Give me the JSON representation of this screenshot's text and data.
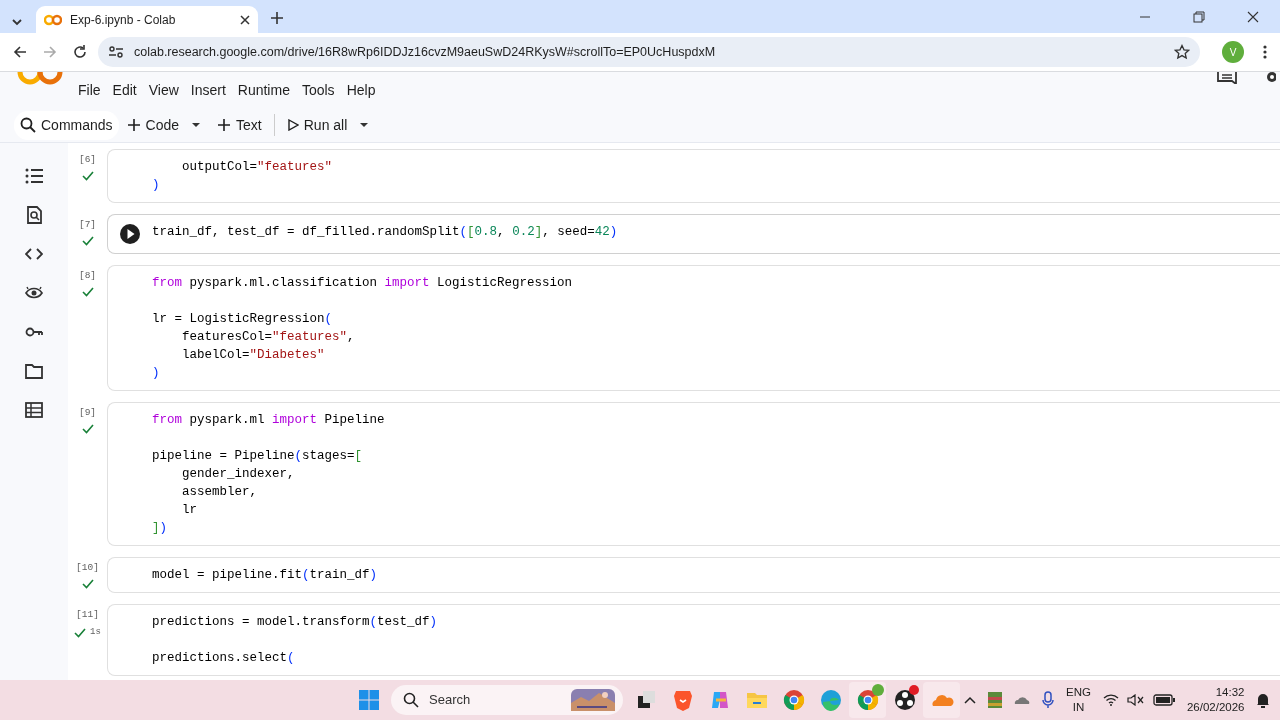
{
  "browser": {
    "tab_title": "Exp-6.ipynb - Colab",
    "url": "colab.research.google.com/drive/16R8wRp6IDDJz16cvzM9aeuSwD24RKysW#scrollTo=EP0UcHuspdxM",
    "avatar_letter": "V"
  },
  "menu": [
    "File",
    "Edit",
    "View",
    "Insert",
    "Runtime",
    "Tools",
    "Help"
  ],
  "toolbar": {
    "commands": "Commands",
    "code": "Code",
    "text": "Text",
    "run_all": "Run all"
  },
  "cells": [
    {
      "number": "[6]",
      "succeeded": true,
      "hovered": false,
      "lines": [
        {
          "parts": [
            {
              "t": "    outputCol=",
              "kind": "plain"
            },
            {
              "t": "\"features\"",
              "kind": "string"
            }
          ]
        },
        {
          "parts": [
            {
              "t": ")",
              "kind": "paren"
            }
          ]
        }
      ]
    },
    {
      "number": "[7]",
      "succeeded": true,
      "hovered": true,
      "lines": [
        {
          "parts": [
            {
              "t": "train_df, test_df = df_filled.randomSplit",
              "kind": "plain"
            },
            {
              "t": "(",
              "kind": "paren"
            },
            {
              "t": "[",
              "kind": "bracket"
            },
            {
              "t": "0.8",
              "kind": "number"
            },
            {
              "t": ", ",
              "kind": "plain"
            },
            {
              "t": "0.2",
              "kind": "number"
            },
            {
              "t": "]",
              "kind": "bracket"
            },
            {
              "t": ", seed=",
              "kind": "plain"
            },
            {
              "t": "42",
              "kind": "number"
            },
            {
              "t": ")",
              "kind": "paren"
            }
          ]
        }
      ]
    },
    {
      "number": "[8]",
      "succeeded": true,
      "hovered": false,
      "lines": [
        {
          "parts": [
            {
              "t": "from",
              "kind": "keyword"
            },
            {
              "t": " pyspark.ml.classification ",
              "kind": "plain"
            },
            {
              "t": "import",
              "kind": "keyword"
            },
            {
              "t": " LogisticRegression",
              "kind": "plain"
            }
          ]
        },
        {
          "spaced": true,
          "parts": [
            {
              "t": "lr = LogisticRegression",
              "kind": "plain"
            },
            {
              "t": "(",
              "kind": "paren"
            }
          ]
        },
        {
          "parts": [
            {
              "t": "    featuresCol=",
              "kind": "plain"
            },
            {
              "t": "\"features\"",
              "kind": "string"
            },
            {
              "t": ",",
              "kind": "plain"
            }
          ]
        },
        {
          "parts": [
            {
              "t": "    labelCol=",
              "kind": "plain"
            },
            {
              "t": "\"Diabetes\"",
              "kind": "string"
            }
          ]
        },
        {
          "parts": [
            {
              "t": ")",
              "kind": "paren"
            }
          ]
        }
      ]
    },
    {
      "number": "[9]",
      "succeeded": true,
      "hovered": false,
      "lines": [
        {
          "parts": [
            {
              "t": "from",
              "kind": "keyword"
            },
            {
              "t": " pyspark.ml ",
              "kind": "plain"
            },
            {
              "t": "import",
              "kind": "keyword"
            },
            {
              "t": " Pipeline",
              "kind": "plain"
            }
          ]
        },
        {
          "spaced": true,
          "parts": [
            {
              "t": "pipeline = Pipeline",
              "kind": "plain"
            },
            {
              "t": "(",
              "kind": "paren"
            },
            {
              "t": "stages=",
              "kind": "plain"
            },
            {
              "t": "[",
              "kind": "bracket"
            }
          ]
        },
        {
          "parts": [
            {
              "t": "    gender_indexer,",
              "kind": "plain"
            }
          ]
        },
        {
          "parts": [
            {
              "t": "    assembler,",
              "kind": "plain"
            }
          ]
        },
        {
          "parts": [
            {
              "t": "    lr",
              "kind": "plain"
            }
          ]
        },
        {
          "parts": [
            {
              "t": "]",
              "kind": "bracket"
            },
            {
              "t": ")",
              "kind": "paren"
            }
          ]
        }
      ]
    },
    {
      "number": "[10]",
      "succeeded": true,
      "hovered": false,
      "lines": [
        {
          "parts": [
            {
              "t": "model = pipeline.fit",
              "kind": "plain"
            },
            {
              "t": "(",
              "kind": "paren"
            },
            {
              "t": "train_df",
              "kind": "plain"
            },
            {
              "t": ")",
              "kind": "paren"
            }
          ]
        }
      ]
    },
    {
      "number": "[11]",
      "succeeded": true,
      "duration": "1s",
      "hovered": false,
      "lines": [
        {
          "parts": [
            {
              "t": "predictions = model.transform",
              "kind": "plain"
            },
            {
              "t": "(",
              "kind": "paren"
            },
            {
              "t": "test_df",
              "kind": "plain"
            },
            {
              "t": ")",
              "kind": "paren"
            }
          ]
        },
        {
          "spaced": true,
          "parts": [
            {
              "t": "predictions.select",
              "kind": "plain"
            },
            {
              "t": "(",
              "kind": "paren"
            }
          ]
        }
      ]
    }
  ],
  "taskbar": {
    "search_placeholder": "Search",
    "language": "ENG",
    "region": "IN",
    "time": "14:32",
    "date": "26/02/2026"
  }
}
